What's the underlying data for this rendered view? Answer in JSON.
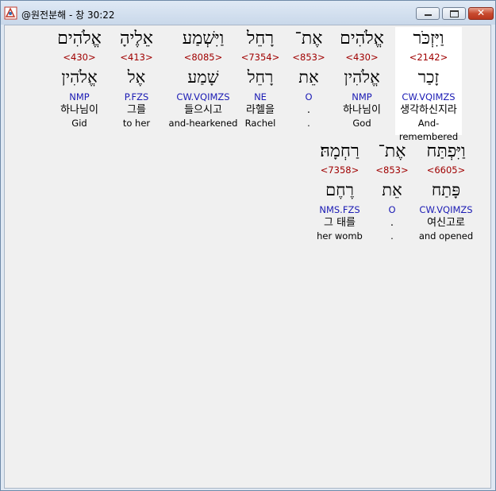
{
  "window": {
    "title": "@원전분해 - 창 30:22",
    "close_glyph": "✕"
  },
  "verse_lines": [
    {
      "words": [
        {
          "hebrew": "וַיִּזְכֹּר",
          "strong": "<2142>",
          "root": "זָכַר",
          "parse": "CW.VQIMZS",
          "korean": "생각하신지라",
          "english": "And-remembered",
          "highlighted": true
        },
        {
          "hebrew": "אֱלֹהִים",
          "strong": "<430>",
          "root": "אֱלֹהִין",
          "parse": "NMP",
          "korean": "하나님이",
          "english": "God",
          "highlighted": false
        },
        {
          "hebrew": "אֶת־",
          "strong": "<853>",
          "root": "אֵת",
          "parse": "O",
          "korean": ".",
          "english": ".",
          "highlighted": false
        },
        {
          "hebrew": "רָחֵל",
          "strong": "<7354>",
          "root": "רָחֵל",
          "parse": "NE",
          "korean": "라헬을",
          "english": "Rachel",
          "highlighted": false
        },
        {
          "hebrew": "וַיִּשְׁמַע",
          "strong": "<8085>",
          "root": "שָׁמַע",
          "parse": "CW.VQIMZS",
          "korean": "들으시고",
          "english": "and-hearkened",
          "highlighted": false
        },
        {
          "hebrew": "אֵלֶיהָ",
          "strong": "<413>",
          "root": "אֶל",
          "parse": "P.FZS",
          "korean": "그를",
          "english": "to her",
          "highlighted": false
        },
        {
          "hebrew": "אֱלֹהִים",
          "strong": "<430>",
          "root": "אֱלֹהִין",
          "parse": "NMP",
          "korean": "하나님이",
          "english": "Gid",
          "highlighted": false
        }
      ]
    },
    {
      "words": [
        {
          "hebrew": "וַיִּפְתַּח",
          "strong": "<6605>",
          "root": "פָּתַח",
          "parse": "CW.VQIMZS",
          "korean": "여신고로",
          "english": "and opened",
          "highlighted": false
        },
        {
          "hebrew": "אֶת־",
          "strong": "<853>",
          "root": "אֵת",
          "parse": "O",
          "korean": ".",
          "english": ".",
          "highlighted": false
        },
        {
          "hebrew": "רַחְמָהּ׃",
          "strong": "<7358>",
          "root": "רֶחֶם",
          "parse": "NMS.FZS",
          "korean": "그 태를",
          "english": "her womb",
          "highlighted": false
        }
      ]
    }
  ],
  "colors": {
    "strong": "#a00000",
    "parse": "#1a1ab4",
    "highlight_bg": "#ffffff"
  }
}
